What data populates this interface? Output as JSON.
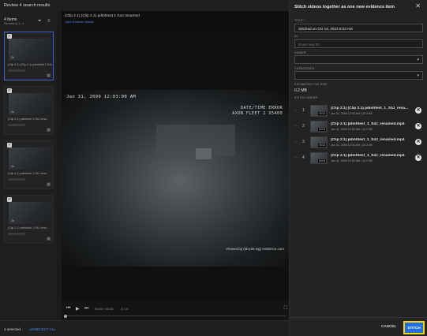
{
  "header": {
    "title": "Review 4 search results"
  },
  "sidebar": {
    "count": "4 Items",
    "sub": "Remaining 1 / 4",
    "cards": [
      {
        "time": "2s",
        "title": "(Clip 2.1) (Clip 2.1) pdinhtest 1 S4J..."
      },
      {
        "time": "2s",
        "title": "(Clip 2.1) pdinhtest 1 S4J rena..."
      },
      {
        "time": "2s",
        "title": "(Clip 2.1) pdinhtest 1 S4J rena..."
      },
      {
        "time": "2s",
        "title": "(Clip 2.1) pdinhtest 1 S4J rena..."
      }
    ]
  },
  "footer": {
    "selected": "4 selected",
    "unselect": "UNSELECT ALL"
  },
  "viewer": {
    "title": "(Clip 2.1) (Clip 2.1) pdinhtest 1 S4J renamed",
    "link": "Open Evidence Details",
    "osd_date": "Jan 31, 2099 12:03:00 AM",
    "osd_error": "DATE/TIME ERROR",
    "osd_device": "AXON FLEET 2 X5400",
    "watermark": "Viewed by (ab-pts-wg) evidence.com",
    "time": "00:00 / 00:03",
    "speed": "1X"
  },
  "panel": {
    "title": "Stitch videos together as one new evidence item",
    "title_label": "TITLE *",
    "title_value": "Stitched on Oct 18, 2023 8:22 AM",
    "id_label": "ID",
    "id_placeholder": "Enter new ID",
    "owner_label": "OWNER",
    "categories_label": "CATEGORIES",
    "size_label": "ESTIMATED FILE SIZE",
    "size_value": "0.2 MB",
    "order_label": "STITCH ORDER",
    "items": [
      {
        "num": "1",
        "title": "(Clip 2.1) (Clip 2.1) pdinhtest_1_S4J_rena...",
        "sub": "Jan 31, 2099 12:03 AM | 43.3 KB",
        "time": "00:03"
      },
      {
        "num": "2",
        "title": "(Clip 2.1) pdinhtest_1_S4J_renamed.mp4",
        "sub": "Jan 31, 2099 12:03 AM | 43.3 KB",
        "time": "00:03"
      },
      {
        "num": "3",
        "title": "(Clip 2.1) pdinhtest_1_S4J_renamed.mp4",
        "sub": "Jan 31, 2099 12:03 AM | 43.3 KB",
        "time": "00:03"
      },
      {
        "num": "4",
        "title": "(Clip 2.1) pdinhtest_1_S4J_renamed.mp4",
        "sub": "Jan 31, 2099 12:03 AM | 43.3 KB",
        "time": "00:03"
      }
    ],
    "cancel": "CANCEL",
    "stitch": "STITCH"
  },
  "colors": {
    "accent": "#1f6fe0",
    "highlight": "#ffd400",
    "link": "#4d85e8"
  }
}
